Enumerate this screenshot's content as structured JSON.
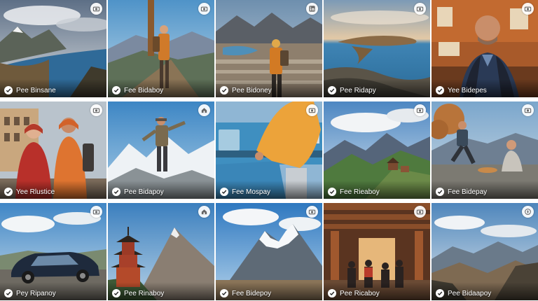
{
  "tiles": [
    {
      "name": "Pee Binsane",
      "badge": "camera-icon",
      "scene": "mountain-lake"
    },
    {
      "name": "Fee Bidaboy",
      "badge": "camera-icon",
      "scene": "hiker-summit"
    },
    {
      "name": "Pee Bidoney",
      "badge": "linkedin-icon",
      "scene": "hiker-city"
    },
    {
      "name": "Pee Ridapy",
      "badge": "camera-icon",
      "scene": "island-bay"
    },
    {
      "name": "Yee Bidepes",
      "badge": "camera-icon",
      "scene": "portrait-man"
    },
    {
      "name": "Yee Rlustice",
      "badge": "camera-icon",
      "scene": "couple-street"
    },
    {
      "name": "Pee Bidapoy",
      "badge": "home-icon",
      "scene": "hiker-snow"
    },
    {
      "name": "Fee Mospay",
      "badge": "camera-icon",
      "scene": "traveler-train"
    },
    {
      "name": "Fee Rieaboy",
      "badge": "camera-icon",
      "scene": "valley-cabins"
    },
    {
      "name": "Fee Bidepay",
      "badge": "camera-icon",
      "scene": "picnic-cliff"
    },
    {
      "name": "Pey Ripanoy",
      "badge": "camera-icon",
      "scene": "car-road"
    },
    {
      "name": "Pee Rinaboy",
      "badge": "home-icon",
      "scene": "pagoda-peak"
    },
    {
      "name": "Fee Bidepoy",
      "badge": "camera-icon",
      "scene": "snow-peak"
    },
    {
      "name": "Pee Ricaboy",
      "badge": "camera-icon",
      "scene": "temple-crowd"
    },
    {
      "name": "Pee Bidaapoy",
      "badge": "compass-icon",
      "scene": "valley-sunset"
    }
  ]
}
